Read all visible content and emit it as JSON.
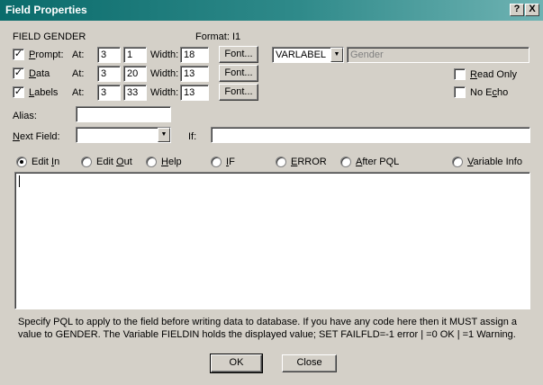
{
  "window": {
    "title": "Field Properties",
    "help_btn": "?",
    "close_btn": "X"
  },
  "field": {
    "name_label": "FIELD GENDER",
    "format_label": "Format: I1"
  },
  "rows": [
    {
      "label_key": "P",
      "label_rest": "rompt:",
      "checked": "✓",
      "at_label": "At:",
      "at_row": "3",
      "at_col": "1",
      "width_label": "Width:",
      "width": "18",
      "font_btn": "Font..."
    },
    {
      "label_key": "D",
      "label_rest": "ata",
      "checked": "✓",
      "at_label": "At:",
      "at_row": "3",
      "at_col": "20",
      "width_label": "Width:",
      "width": "13",
      "font_btn": "Font..."
    },
    {
      "label_key": "L",
      "label_rest": "abels",
      "checked": "✓",
      "at_label": "At:",
      "at_row": "3",
      "at_col": "33",
      "width_label": "Width:",
      "width": "13",
      "font_btn": "Font..."
    }
  ],
  "label_source": {
    "selected": "VARLABEL",
    "arrow": "▼",
    "value": "Gender"
  },
  "options": {
    "read_only": {
      "key": "R",
      "rest": "ead Only"
    },
    "no_echo": {
      "pre": "No E",
      "key": "c",
      "post": "ho"
    }
  },
  "alias": {
    "label": "Alias:",
    "value": ""
  },
  "next_field": {
    "key": "N",
    "rest": "ext Field:",
    "value": "",
    "arrow": "▼"
  },
  "if_field": {
    "label": "If:",
    "value": ""
  },
  "pql_tabs": [
    {
      "pre": "Edit ",
      "key": "I",
      "post": "n",
      "selected": true
    },
    {
      "pre": "Edit ",
      "key": "O",
      "post": "ut",
      "selected": false
    },
    {
      "pre": "",
      "key": "H",
      "post": "elp",
      "selected": false
    },
    {
      "pre": "",
      "key": "I",
      "post": "F",
      "selected": false
    },
    {
      "pre": "",
      "key": "E",
      "post": "RROR",
      "selected": false
    },
    {
      "pre": "",
      "key": "A",
      "post": "fter PQL",
      "selected": false
    },
    {
      "pre": "",
      "key": "V",
      "post": "ariable Info",
      "selected": false
    }
  ],
  "editor": {
    "content": ""
  },
  "help_text": "Specify PQL to apply to the field before writing data to database. If you have any code here then it MUST assign a value to GENDER. The Variable FIELDIN holds the displayed value; SET FAILFLD=-1 error | =0 OK | =1 Warning.",
  "buttons": {
    "ok": "OK",
    "close": "Close"
  }
}
